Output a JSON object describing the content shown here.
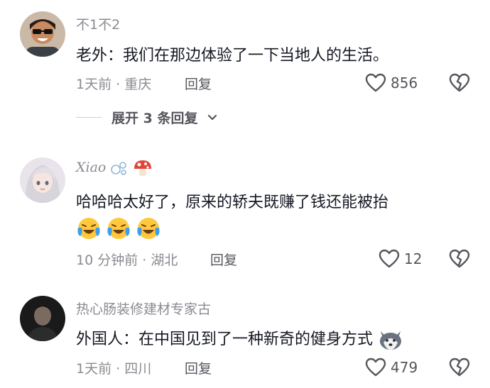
{
  "comments": [
    {
      "username": "不1不2",
      "text": "老外：我们在那边体验了一下当地人的生活。",
      "time": "1天前",
      "location": "重庆",
      "reply_label": "回复",
      "likes": "856",
      "expand_label": "展开 3 条回复",
      "avatar_icon": "man-sunglasses-avatar"
    },
    {
      "username": "Xiao",
      "text": "哈哈哈太好了，原来的轿夫既赚了钱还能被抬",
      "emojis": [
        "laughing-crying-emoji",
        "laughing-crying-emoji",
        "laughing-crying-emoji"
      ],
      "time": "10 分钟前",
      "location": "湖北",
      "reply_label": "回复",
      "likes": "12",
      "avatar_icon": "anime-girl-avatar"
    },
    {
      "username": "热心肠装修建材专家古",
      "text": "外国人：在中国见到了一种新奇的健身方式",
      "time": "1天前",
      "location": "四川",
      "reply_label": "回复",
      "likes": "479",
      "avatar_icon": "man-dark-avatar"
    }
  ],
  "separator": " · ",
  "colors": {
    "text": "#161823",
    "secondary": "#8a8b91",
    "action": "#55565c"
  }
}
